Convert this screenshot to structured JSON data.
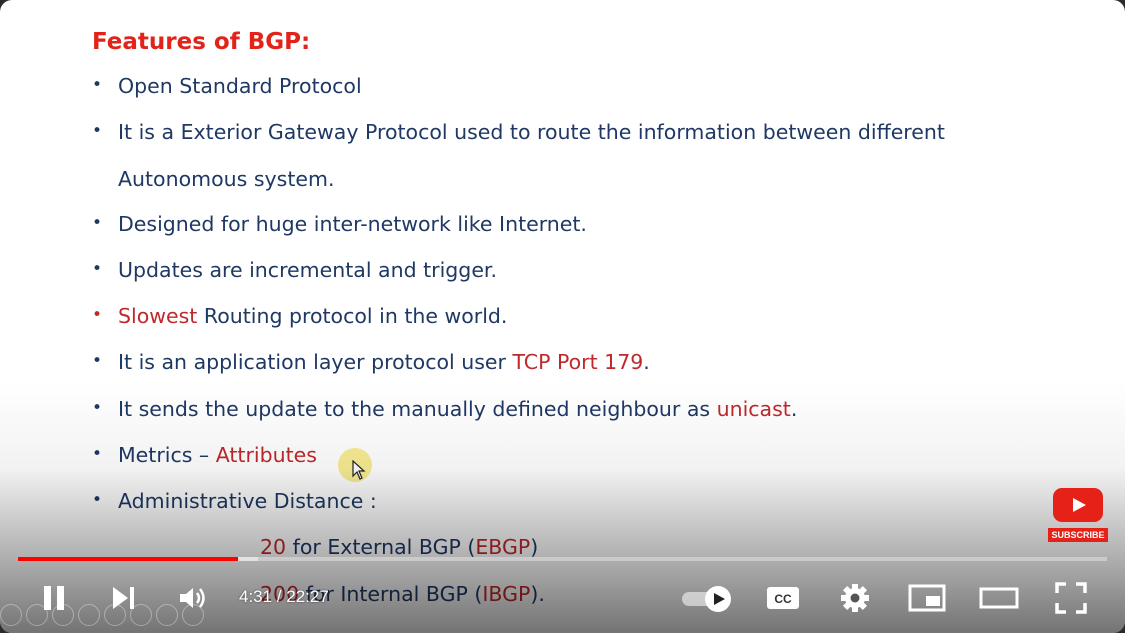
{
  "slide": {
    "title": "Features of BGP:",
    "bullets": [
      {
        "dot": "•",
        "text": "Open Standard Protocol"
      },
      {
        "dot": "•",
        "line1": "It is a Exterior Gateway Protocol used to route the information between different",
        "line2": "Autonomous system."
      },
      {
        "dot": "•",
        "text": "Designed for huge inter-network like Internet."
      },
      {
        "dot": "•",
        "text": "Updates are incremental and trigger."
      },
      {
        "dot": "•",
        "highlight": "Slowest",
        "rest": " Routing protocol in the world."
      },
      {
        "dot": "•",
        "text": "It is an application layer protocol user ",
        "highlight": "TCP Port 179",
        "end": "."
      },
      {
        "dot": "•",
        "text": "It sends the update to the manually defined neighbour as ",
        "highlight": "unicast",
        "end": "."
      },
      {
        "dot": "•",
        "text": "Metrics – ",
        "highlight": "Attributes"
      },
      {
        "dot": "•",
        "text": "Administrative Distance :"
      }
    ],
    "sub": [
      {
        "num": "20",
        "text": " for External BGP (",
        "code": "EBGP",
        "end": ")"
      },
      {
        "num": "200",
        "text": " for Internal BGP (",
        "code": "IBGP",
        "end": ")."
      }
    ]
  },
  "player": {
    "time": "4:31 / 22:27",
    "progress_played": 0.202,
    "progress_loaded": 0.22,
    "subscribe_label": "SUBSCRIBE",
    "autoplay": true,
    "icons": [
      "pause-icon",
      "next-icon",
      "volume-icon",
      "autoplay-toggle",
      "cc-icon",
      "settings-icon",
      "miniplayer-icon",
      "theater-icon",
      "fullscreen-icon"
    ]
  },
  "colors": {
    "accent": "#ff0000",
    "title": "#e2231a",
    "text": "#1f3864",
    "highlight": "#c0282b"
  }
}
